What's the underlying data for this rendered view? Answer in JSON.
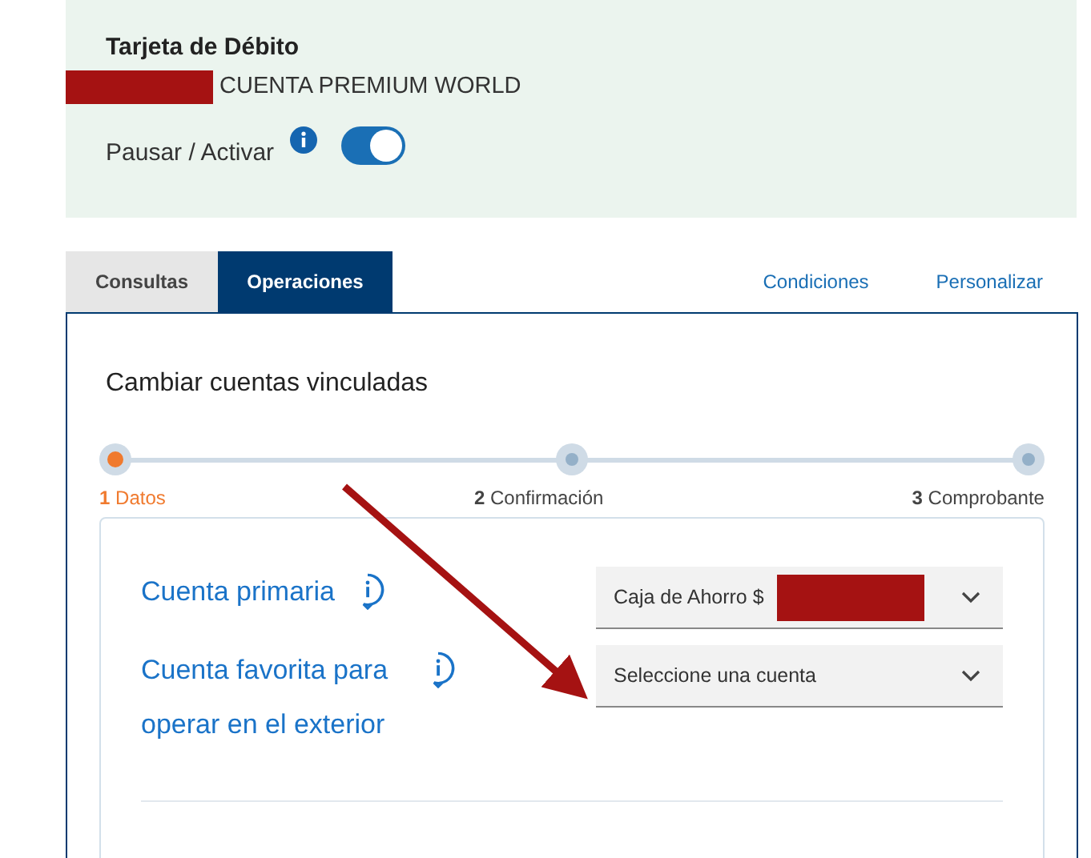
{
  "card": {
    "title": "Tarjeta de Débito",
    "account_name": "CUENTA PREMIUM WORLD",
    "toggle": {
      "label": "Pausar / Activar",
      "on": true
    }
  },
  "tabs": [
    {
      "label": "Consultas",
      "selected": false
    },
    {
      "label": "Operaciones",
      "selected": true
    }
  ],
  "links": [
    "Condiciones",
    "Personalizar"
  ],
  "panel": {
    "title": "Cambiar cuentas vinculadas",
    "steps": [
      {
        "number": "1",
        "label": "Datos",
        "selected": true
      },
      {
        "number": "2",
        "label": "Confirmación",
        "selected": false
      },
      {
        "number": "3",
        "label": "Comprobante",
        "selected": false
      }
    ],
    "fields": [
      {
        "label": "Cuenta primaria",
        "value": "Caja de Ahorro $"
      },
      {
        "label": "Cuenta favorita para operar en el exterior",
        "placeholder": "Seleccione una cuenta"
      }
    ]
  }
}
